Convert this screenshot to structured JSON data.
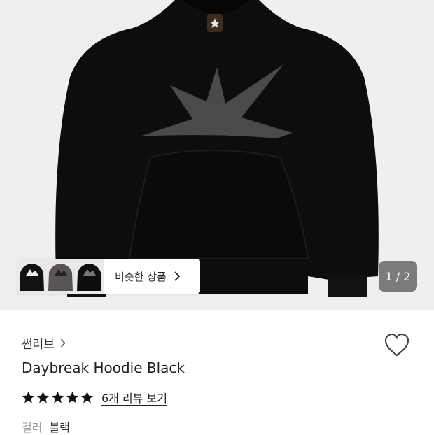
{
  "hero": {
    "similar_label": "비슷한 상품",
    "pager": "1 / 2"
  },
  "product": {
    "brand": "썬러브",
    "title": "Daybreak Hoodie Black",
    "rating": 5,
    "review_link": "6개 리뷰 보기",
    "option_key": "컬러",
    "option_value": "블랙"
  },
  "colors": {
    "hero_bg": "#efefef",
    "garment": "#0d0d0d",
    "graphic": "#4a4a4a",
    "star": "#111111"
  }
}
